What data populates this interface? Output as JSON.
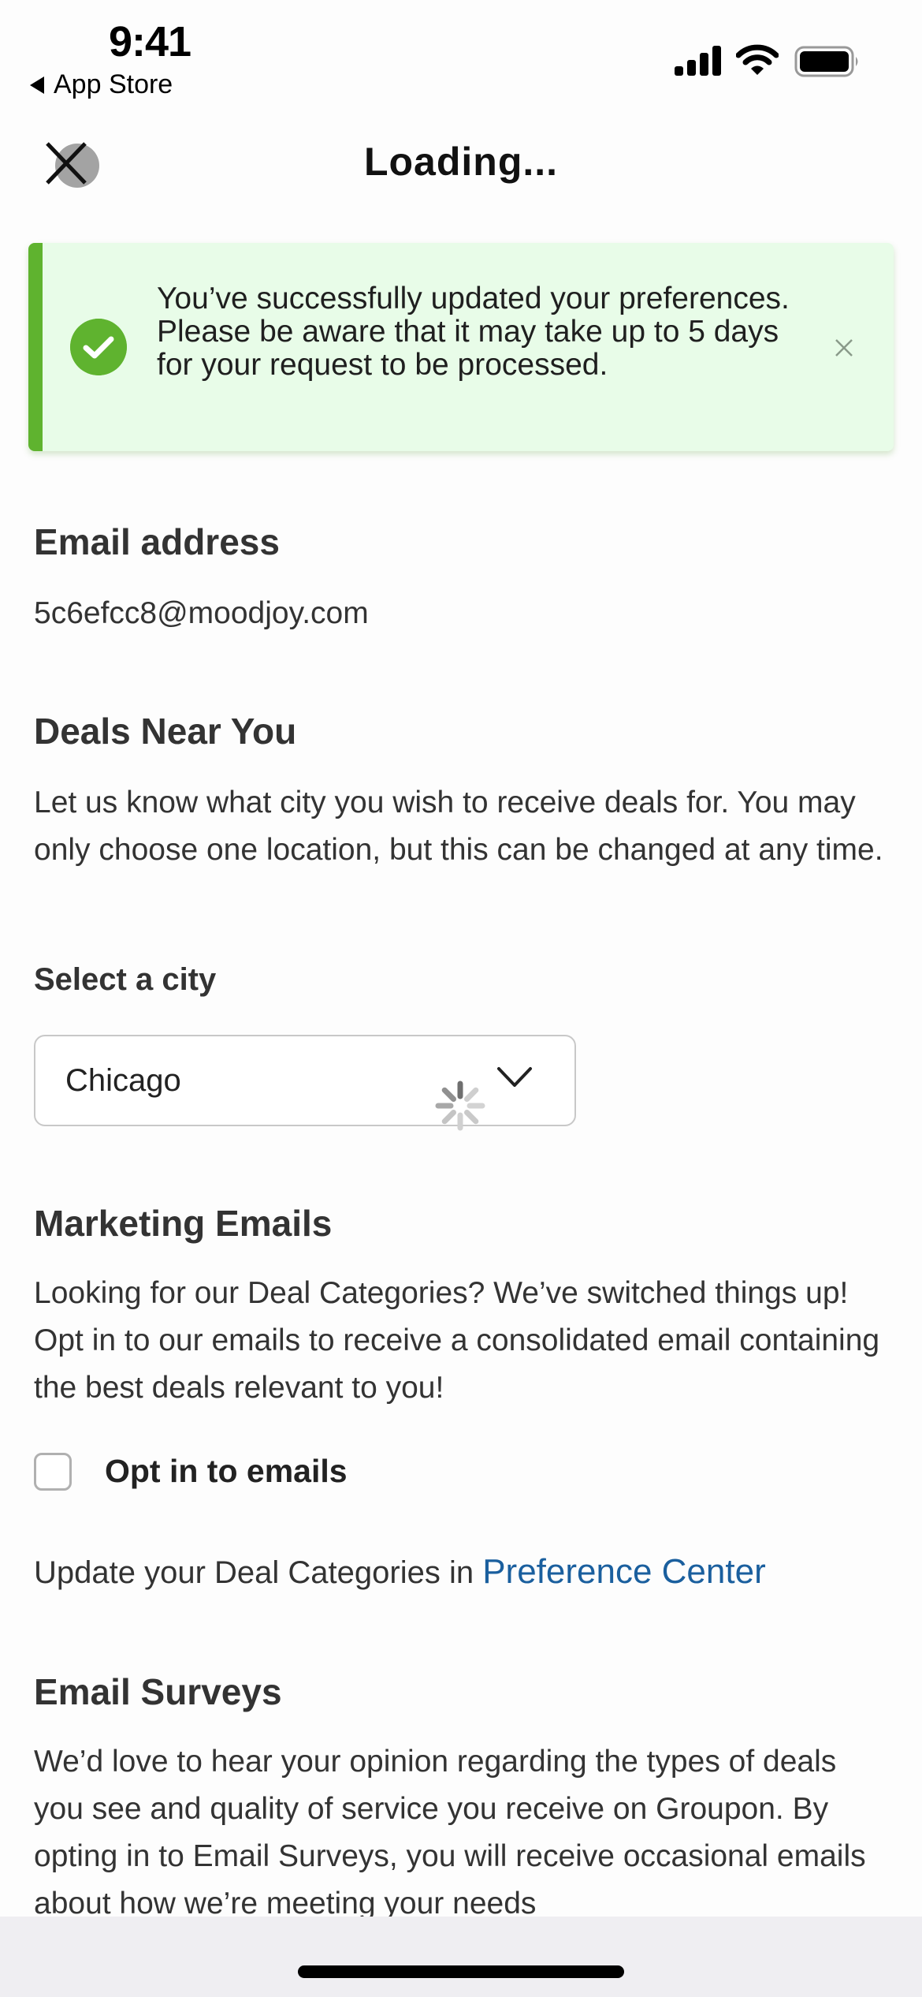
{
  "status_bar": {
    "time": "9:41",
    "back_label": "App Store",
    "icons": [
      "signal-icon",
      "wifi-icon",
      "battery-icon"
    ]
  },
  "header": {
    "title": "Loading...",
    "close_icon": "close-icon"
  },
  "banner": {
    "type": "success",
    "icon": "check-circle-icon",
    "message": "You’ve successfully updated your preferences. Please be aware that it may take up to 5 days for your request to be processed.",
    "dismiss_icon": "close-icon",
    "accent_color": "#5fb32f",
    "background_color": "#e8fce8"
  },
  "email_section": {
    "heading": "Email address",
    "value": "5c6efcc8@moodjoy.com"
  },
  "deals_section": {
    "heading": "Deals Near You",
    "description": "Let us know what city you wish to receive deals for. You may only choose one location, but this can be changed at any time.",
    "select_label": "Select a city",
    "selected_city": "Chicago",
    "loading": true
  },
  "marketing_section": {
    "heading": "Marketing Emails",
    "description": "Looking for our Deal Categories? We’ve switched things up! Opt in to our emails to receive a consolidated email containing the best deals relevant to you!",
    "checkbox_label": "Opt in to emails",
    "checkbox_checked": false,
    "update_prefix": "Update your Deal Categories in ",
    "update_link": "Preference Center",
    "link_color": "#1a5f9e"
  },
  "surveys_section": {
    "heading": "Email Surveys",
    "description": "We’d love to hear your opinion regarding the types of deals you see and quality of service you receive on Groupon. By opting in to Email Surveys, you will receive occasional emails about how we’re meeting your needs"
  }
}
